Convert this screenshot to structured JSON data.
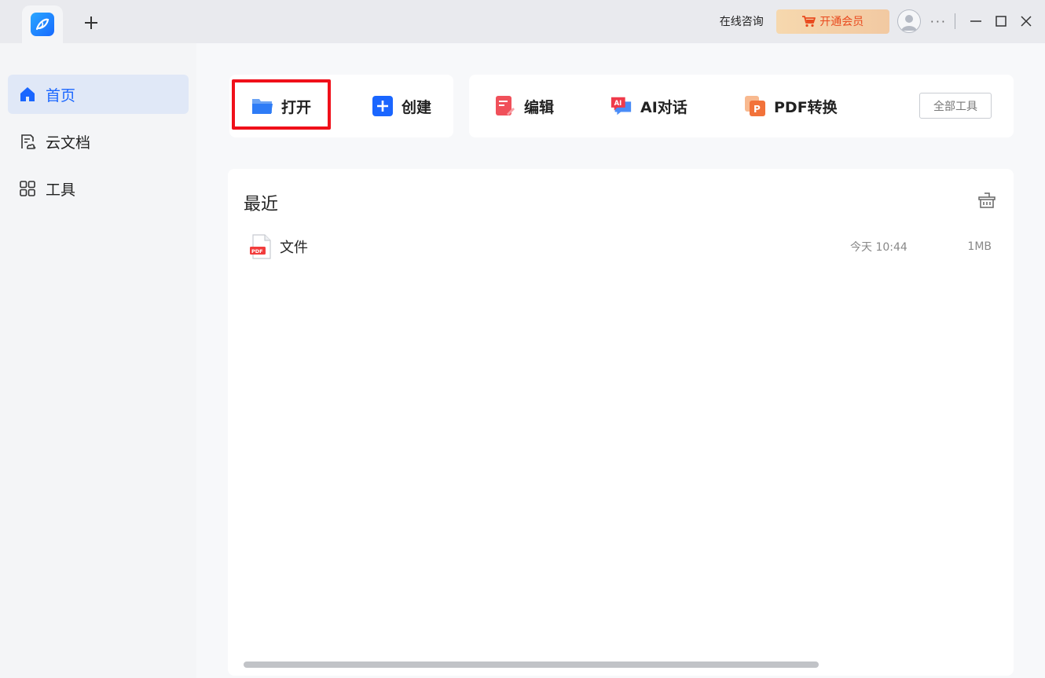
{
  "titlebar": {
    "consult": "在线咨询",
    "vip_label": "开通会员",
    "more": "···"
  },
  "sidebar": {
    "items": [
      {
        "label": "首页",
        "icon": "home-icon",
        "active": true
      },
      {
        "label": "云文档",
        "icon": "cloud-doc-icon",
        "active": false
      },
      {
        "label": "工具",
        "icon": "grid-icon",
        "active": false
      }
    ]
  },
  "toolbar": {
    "open": "打开",
    "create": "创建",
    "edit": "编辑",
    "ai_chat": "AI对话",
    "pdf_convert": "PDF转换",
    "all_tools": "全部工具"
  },
  "recent": {
    "title": "最近",
    "files": [
      {
        "name": "文件",
        "time": "今天 10:44",
        "size": "1MB"
      }
    ]
  },
  "colors": {
    "accent": "#1a66ff",
    "highlight": "#f0101a",
    "vip_text": "#e94a1e"
  }
}
